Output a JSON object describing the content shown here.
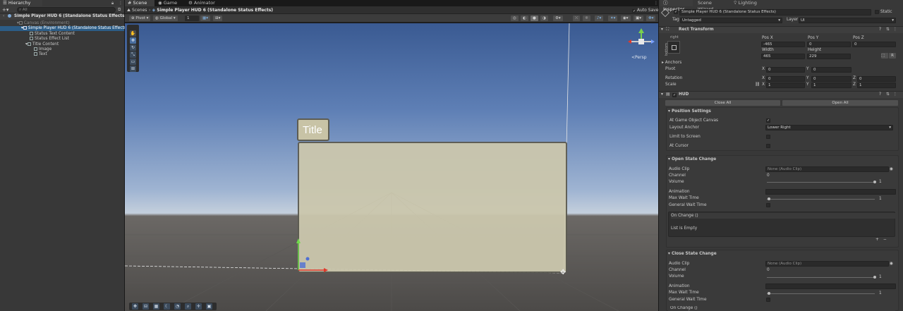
{
  "hierarchy": {
    "tab": "Hierarchy",
    "search_placeholder": "All",
    "scene": "Simple Player HUD 6 (Standalone Status Effects)",
    "items": [
      {
        "label": "Canvas (Environment)",
        "depth": 1,
        "dim": true
      },
      {
        "label": "Simple Player HUD 6 (Standalone Status Effects)",
        "depth": 2,
        "selected": true
      },
      {
        "label": "Status Text Content",
        "depth": 3
      },
      {
        "label": "Status Effect List",
        "depth": 3
      },
      {
        "label": "Title Content",
        "depth": 3
      },
      {
        "label": "Image",
        "depth": 4
      },
      {
        "label": "Text",
        "depth": 4
      }
    ]
  },
  "scene_view": {
    "tabs": [
      "Scene",
      "Game",
      "Animator"
    ],
    "breadcrumb_root": "Scenes",
    "breadcrumb_item": "Simple Player HUD 6 (Standalone Status Effects)",
    "auto_save": "Auto Save",
    "pivot": "Pivot",
    "global": "Global",
    "grid_size": "1",
    "persp": "<Persp",
    "title_text": "Title"
  },
  "inspector": {
    "tabs": [
      "Inspector",
      "Scene Wizard",
      "Lighting"
    ],
    "object_name": "Simple Player HUD 6 (Standalone Status Effects)",
    "static_label": "Static",
    "tag_label": "Tag",
    "tag_value": "Untagged",
    "layer_label": "Layer",
    "layer_value": "UI",
    "rect_transform": {
      "title": "Rect Transform",
      "anchor_h": "right",
      "anchor_v": "bottom",
      "pos_x_label": "Pos X",
      "pos_x": "-465",
      "pos_y_label": "Pos Y",
      "pos_y": "0",
      "pos_z_label": "Pos Z",
      "pos_z": "0",
      "width_label": "Width",
      "width": "465",
      "height_label": "Height",
      "height": "229",
      "anchors_label": "Anchors",
      "pivot_label": "Pivot",
      "pivot_x": "0",
      "pivot_y": "0",
      "rotation_label": "Rotation",
      "rot_x": "0",
      "rot_y": "0",
      "rot_z": "0",
      "scale_label": "Scale",
      "scale_x": "1",
      "scale_y": "1",
      "scale_z": "1",
      "x": "X",
      "y": "Y",
      "z": "Z",
      "r_btn": "R"
    },
    "hud": {
      "title": "HUD",
      "close_all": "Close All",
      "open_all": "Open All",
      "position_settings": "Position Settings",
      "at_game_object_canvas": "At Game Object Canvas",
      "layout_anchor_label": "Layout Anchor",
      "layout_anchor_value": "Lower Right",
      "limit_to_screen": "Limit to Screen",
      "at_cursor": "At Cursor",
      "open_state_change": "Open State Change",
      "close_state_change": "Close State Change",
      "audio_clip": "Audio Clip",
      "audio_clip_value": "None (Audio Clip)",
      "channel": "Channel",
      "channel_value": "0",
      "volume": "Volume",
      "volume_value": "1",
      "animation": "Animation",
      "max_wait_time": "Max Wait Time",
      "max_wait_value": "1",
      "general_wait_time": "General Wait Time",
      "on_change": "On Change ()",
      "list_empty": "List is Empty",
      "plus": "+",
      "minus": "−"
    }
  }
}
